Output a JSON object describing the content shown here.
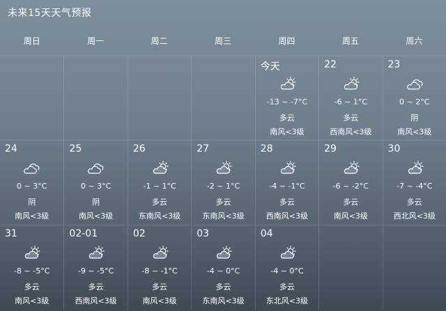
{
  "page": {
    "title": "未来15天天气预报"
  },
  "weekdays": [
    "周日",
    "周一",
    "周二",
    "周三",
    "周四",
    "周五",
    "周六"
  ],
  "rows": [
    [
      null,
      null,
      null,
      null,
      {
        "date": "今天",
        "icon": "partly-cloudy-icon",
        "temp": "-13 ~ -7°C",
        "desc": "多云",
        "wind": "南风<3级"
      },
      {
        "date": "22",
        "icon": "partly-cloudy-icon",
        "temp": "-6 ~ 1°C",
        "desc": "多云",
        "wind": "西南风<3级"
      },
      {
        "date": "23",
        "icon": "overcast-cloud-icon",
        "temp": "0 ~ 2°C",
        "desc": "阴",
        "wind": "南风<3级"
      }
    ],
    [
      {
        "date": "24",
        "icon": "overcast-cloud-icon",
        "temp": "0 ~ 3°C",
        "desc": "阴",
        "wind": "南风<3级"
      },
      {
        "date": "25",
        "icon": "overcast-cloud-icon",
        "temp": "0 ~ 3°C",
        "desc": "阴",
        "wind": "南风<3级"
      },
      {
        "date": "26",
        "icon": "partly-cloudy-icon",
        "temp": "-1 ~ 1°C",
        "desc": "多云",
        "wind": "东南风<3级"
      },
      {
        "date": "27",
        "icon": "partly-cloudy-icon",
        "temp": "-2 ~ 1°C",
        "desc": "多云",
        "wind": "东南风<3级"
      },
      {
        "date": "28",
        "icon": "partly-cloudy-icon",
        "temp": "-4 ~ -1°C",
        "desc": "多云",
        "wind": "西南风<3级"
      },
      {
        "date": "29",
        "icon": "partly-cloudy-icon",
        "temp": "-6 ~ -2°C",
        "desc": "多云",
        "wind": "南风<3级"
      },
      {
        "date": "30",
        "icon": "partly-cloudy-icon",
        "temp": "-7 ~ -4°C",
        "desc": "多云",
        "wind": "西北风<3级"
      }
    ],
    [
      {
        "date": "31",
        "icon": "partly-cloudy-icon",
        "temp": "-8 ~ -5°C",
        "desc": "多云",
        "wind": "南风<3级"
      },
      {
        "date": "02-01",
        "icon": "partly-cloudy-icon",
        "temp": "-9 ~ -5°C",
        "desc": "多云",
        "wind": "西南风<3级"
      },
      {
        "date": "02",
        "icon": "partly-cloudy-icon",
        "temp": "-8 ~ -1°C",
        "desc": "多云",
        "wind": "南风<3级"
      },
      {
        "date": "03",
        "icon": "partly-cloudy-icon",
        "temp": "-4 ~ 0°C",
        "desc": "多云",
        "wind": "东南风<3级"
      },
      {
        "date": "04",
        "icon": "partly-cloudy-icon",
        "temp": "-4 ~ 0°C",
        "desc": "多云",
        "wind": "东北风<3级"
      },
      null,
      null
    ]
  ]
}
